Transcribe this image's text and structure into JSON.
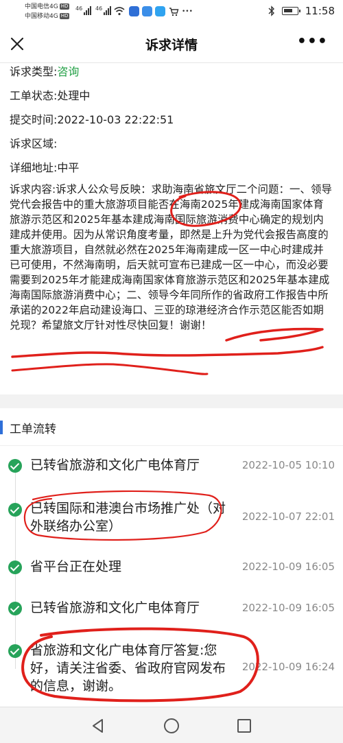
{
  "status": {
    "carrier1": "中国电信4G",
    "carrier2": "中国移动4G",
    "hd": "HD",
    "net1": "46",
    "net2": "46",
    "time": "11:58",
    "bluetooth_icon": "bluetooth-icon",
    "battery_icon": "battery-icon"
  },
  "nav": {
    "title": "诉求详情",
    "more": "•••",
    "close_icon": "close-icon"
  },
  "detail": {
    "type_label": "诉求类型:",
    "type_value": "咨询",
    "state": "工单状态:处理中",
    "submit_time": "提交时间:2022-10-03 22:22:51",
    "region": "诉求区域:",
    "address": "详细地址:中平",
    "content": "诉求内容:诉求人公众号反映：求助海南省旅文厅二个问题：一、领导党代会报告中的重大旅游项目能否在海南2025年建成海南国家体育旅游示范区和2025年基本建成海南国际旅游消费中心确定的规划内建成并使用。因为从常识角度考量，即然是上升为党代会报告高度的重大旅游项目，自然就必然在2025年海南建成一区一中心时建成并已可使用，不然海南明，后天就可宣布已建成一区一中心，而没必要需要到2025年才能建成海南国家体育旅游示范区和2025年基本建成海南国际旅游消费中心；二、领导今年同所作的省政府工作报告中所承诺的2022年启动建设海口、三亚的琼港经济合作示范区能否如期兑现？希望旅文厅针对性尽快回复！谢谢！"
  },
  "flow": {
    "title": "工单流转",
    "items": [
      {
        "text": "已转省旅游和文化广电体育厅",
        "time": "2022-10-05 10:10"
      },
      {
        "text": "已转国际和港澳台市场推广处（对外联络办公室）",
        "time": "2022-10-07 22:01"
      },
      {
        "text": "省平台正在处理",
        "time": "2022-10-09 16:05"
      },
      {
        "text": "已转省旅游和文化广电体育厅",
        "time": "2022-10-09 16:05"
      },
      {
        "text": "省旅游和文化广电体育厅答复:您好，请关注省委、省政府官网发布的信息，谢谢。",
        "time": "2022-10-09 16:24"
      }
    ]
  },
  "colors": {
    "accent_green": "#23a046",
    "check_green": "#27a35a",
    "section_bar_blue": "#2e6fd8",
    "annotation_red": "#e0201b"
  }
}
